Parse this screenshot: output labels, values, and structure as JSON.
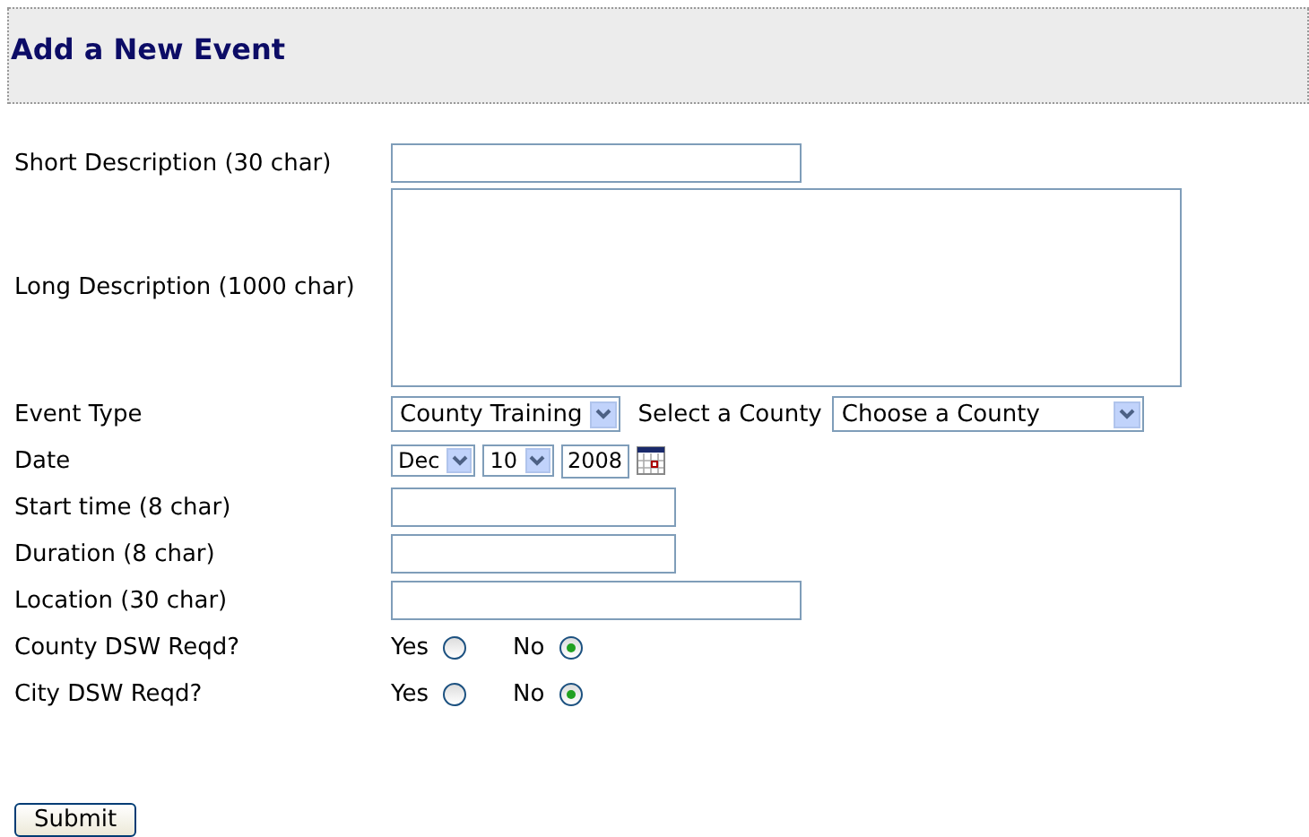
{
  "header": {
    "title": "Add a New Event"
  },
  "fields": [
    {
      "kind": "long_text",
      "label": "Short Description (30 char)"
    },
    {
      "kind": "textarea",
      "label": "Long Description (1000 char)"
    },
    {
      "kind": "selects",
      "label": "Event Type",
      "event_type": "County Training",
      "county_label": "Select a County",
      "county": "Choose a County"
    },
    {
      "kind": "date",
      "label": "Date",
      "month": "Dec",
      "day": "10",
      "year": "2008"
    },
    {
      "kind": "short_text",
      "label": "Start time (8 char)"
    },
    {
      "kind": "short_text",
      "label": "Duration (8 char)"
    },
    {
      "kind": "long_text",
      "label": "Location (30 char)"
    },
    {
      "kind": "radio",
      "label": "County DSW Reqd?",
      "options": [
        {
          "label": "Yes",
          "selected": false
        },
        {
          "label": "No",
          "selected": true
        }
      ]
    },
    {
      "kind": "radio",
      "label": "City DSW Reqd?",
      "options": [
        {
          "label": "Yes",
          "selected": false
        },
        {
          "label": "No",
          "selected": true
        }
      ]
    }
  ],
  "submit": "Submit"
}
